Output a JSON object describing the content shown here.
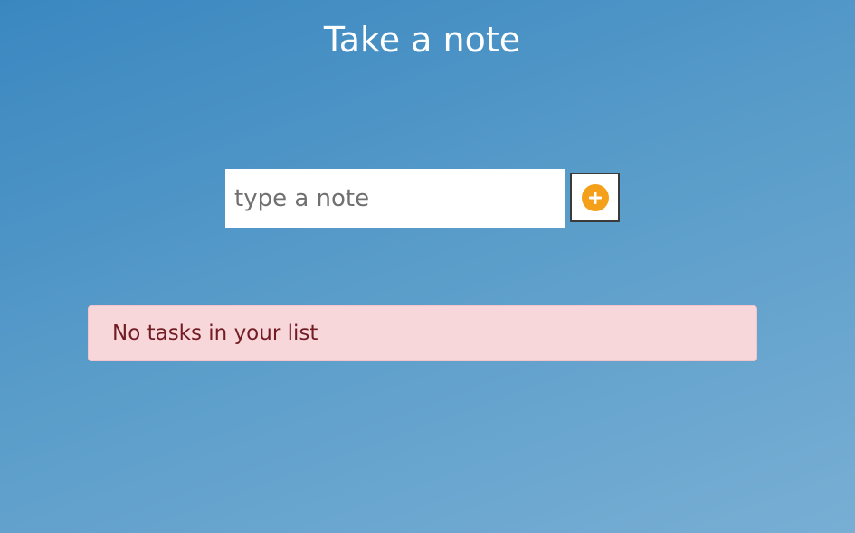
{
  "header": {
    "title": "Take a note"
  },
  "form": {
    "input_value": "",
    "input_placeholder": "type a note",
    "add_button_icon": "plus-circle-icon",
    "accent_color": "#f5a01a"
  },
  "list": {
    "empty_message": "No tasks in your list"
  }
}
